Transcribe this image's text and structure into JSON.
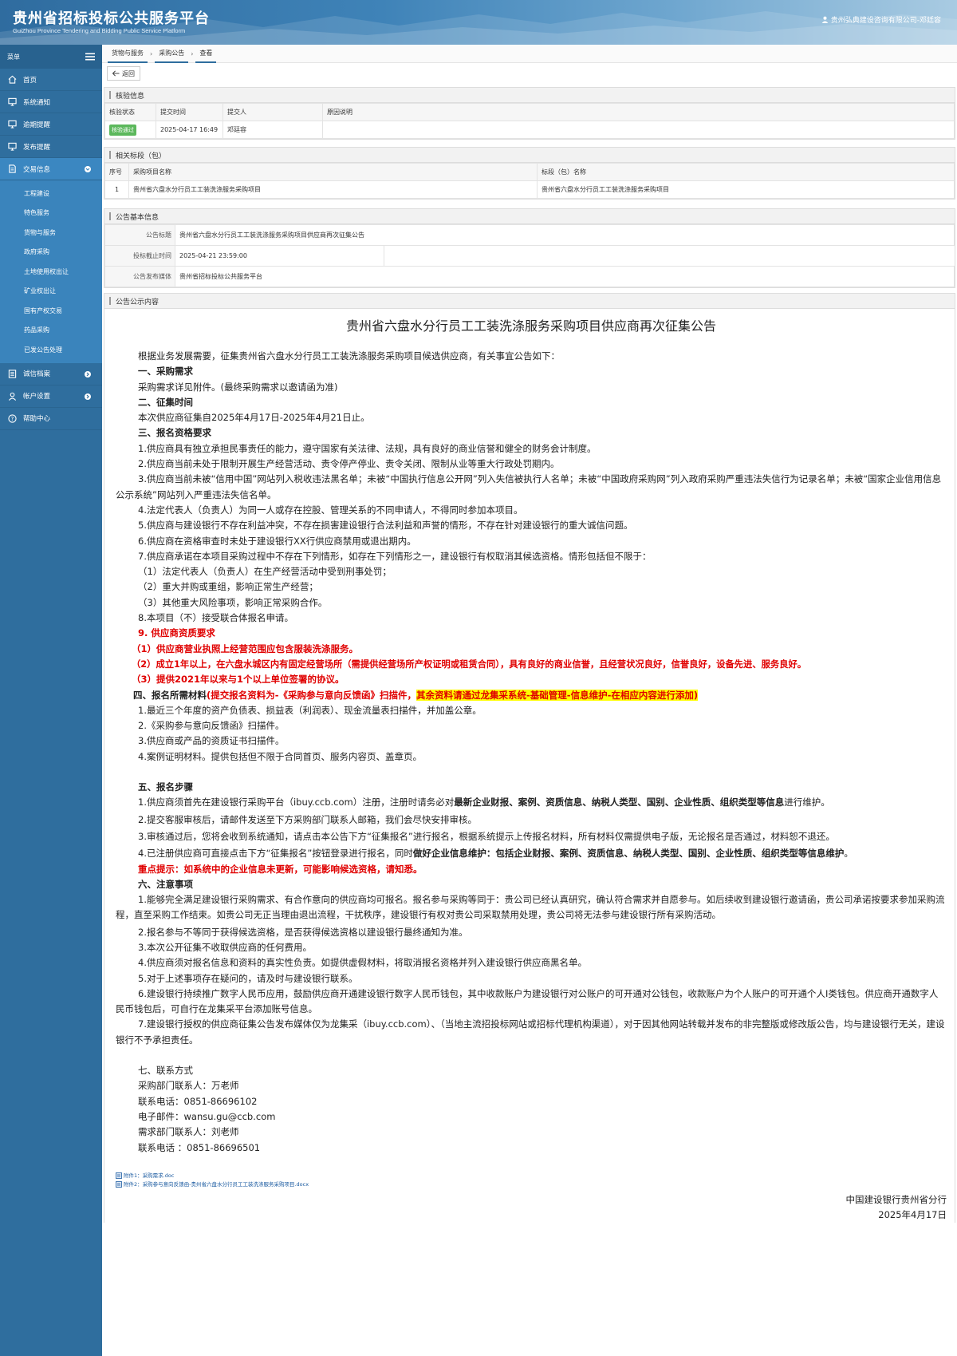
{
  "header": {
    "title": "贵州省招标投标公共服务平台",
    "subtitle": "GuiZhou Province Tendering and Bidding Public Service Platform",
    "user": "贵州弘典建设咨询有限公司-邓廷容"
  },
  "sidebar": {
    "menu_label": "菜单",
    "items": [
      {
        "label": "首页",
        "icon": "home-icon"
      },
      {
        "label": "系统通知",
        "icon": "monitor-icon"
      },
      {
        "label": "逾期提醒",
        "icon": "monitor-icon"
      },
      {
        "label": "发布提醒",
        "icon": "monitor-icon"
      },
      {
        "label": "交易信息",
        "icon": "file-icon"
      },
      {
        "label": "诚信档案",
        "icon": "list-icon"
      },
      {
        "label": "帐户设置",
        "icon": "user-icon"
      },
      {
        "label": "帮助中心",
        "icon": "help-icon"
      }
    ],
    "subitems": [
      "工程建设",
      "特色服务",
      "货物与服务",
      "政府采购",
      "土地使用权出让",
      "矿业权出让",
      "国有产权交易",
      "药品采购",
      "已发公告处理"
    ]
  },
  "breadcrumb": [
    "货物与服务",
    "采购公告",
    "查看"
  ],
  "toolbar": {
    "back_label": "返回"
  },
  "audit": {
    "title": "核验信息",
    "headers": [
      "核验状态",
      "提交时间",
      "提交人",
      "原因说明"
    ],
    "status": "核验通过",
    "time": "2025-04-17 16:49",
    "person": "邓廷容",
    "reason": ""
  },
  "sections": {
    "title": "相关标段（包）",
    "headers": [
      "序号",
      "采购项目名称",
      "标段（包）名称"
    ],
    "rows": [
      {
        "no": "1",
        "project": "贵州省六盘水分行员工工装洗涤服务采购项目",
        "section": "贵州省六盘水分行员工工装洗涤服务采购项目"
      }
    ]
  },
  "basic": {
    "title": "公告基本信息",
    "title_label": "公告标题",
    "title_value": "贵州省六盘水分行员工工装洗涤服务采购项目供应商再次征集公告",
    "deadline_label": "投标截止时间",
    "deadline_value": "2025-04-21 23:59:00",
    "media_label": "公告发布媒体",
    "media_value": "贵州省招标投标公共服务平台"
  },
  "content": {
    "panel_title": "公告公示内容",
    "doc_title": "贵州省六盘水分行员工工装洗涤服务采购项目供应商再次征集公告",
    "intro": "根据业务发展需要，征集贵州省六盘水分行员工工装洗涤服务采购项目候选供应商，有关事宜公告如下：",
    "h1": "一、采购需求",
    "p1": "采购需求详见附件。(最终采购需求以邀请函为准)",
    "h2": "二、征集时间",
    "p2": "本次供应商征集自2025年4月17日-2025年4月21日止。",
    "h3": "三、报名资格要求",
    "q1": "1.供应商具有独立承担民事责任的能力，遵守国家有关法律、法规，具有良好的商业信誉和健全的财务会计制度。",
    "q2": "2.供应商当前未处于限制开展生产经营活动、责令停产停业、责令关闭、限制从业等重大行政处罚期内。",
    "q3": "3.供应商当前未被“信用中国”网站列入税收违法黑名单；未被“中国执行信息公开网”列入失信被执行人名单；未被“中国政府采购网”列入政府采购严重违法失信行为记录名单；未被“国家企业信用信息公示系统”网站列入严重违法失信名单。",
    "q4": "4.法定代表人（负责人）为同一人或存在控股、管理关系的不同申请人，不得同时参加本项目。",
    "q5": "5.供应商与建设银行不存在利益冲突，不存在损害建设银行合法利益和声誉的情形，不存在针对建设银行的重大诚信问题。",
    "q6": "6.供应商在资格审查时未处于建设银行XX行供应商禁用或退出期内。",
    "q7": "7.供应商承诺在本项目采购过程中不存在下列情形，如存在下列情形之一，建设银行有权取消其候选资格。情形包括但不限于：",
    "q7a": "（1）法定代表人（负责人）在生产经营活动中受到刑事处罚；",
    "q7b": "（2）重大并购或重组，影响正常生产经营；",
    "q7c": "（3）其他重大风险事项，影响正常采购合作。",
    "q8": "8.本项目（不）接受联合体报名申请。",
    "q9": "9. 供应商资质要求",
    "q9a": "（1）供应商营业执照上经营范围应包含服装洗涤服务。",
    "q9b": "（2）成立1年以上，在六盘水城区内有固定经营场所（需提供经营场所产权证明或租赁合同），具有良好的商业信誉，且经营状况良好，信誉良好，设备先进、服务良好。",
    "q9c": "（3）提供2021年以来与1个以上单位签署的协议。",
    "h4": "四、报名所需材料",
    "h4_red": "(提交报名资料为-《采购参与意向反馈函》扫描件，",
    "h4_hl": "其余资料请通过龙集采系统-基础管理-信息维护-在相应内容进行添加)",
    "m1": "1.最近三个年度的资产负债表、损益表（利润表）、现金流量表扫描件，并加盖公章。",
    "m2": "2.《采购参与意向反馈函》扫描件。",
    "m3": "3.供应商或产品的资质证书扫描件。",
    "m4": "4.案例证明材料。提供包括但不限于合同首页、服务内容页、盖章页。",
    "h5": "五、报名步骤",
    "s1a": "1.供应商须首先在建设银行采购平台（ibuy.ccb.com）注册，注册时请务必对",
    "s1b": "最新企业财报、案例、资质信息、纳税人类型、国别、企业性质、组织类型等信息",
    "s1c": "进行维护。",
    "s2": "2.提交客服审核后，请邮件发送至下方采购部门联系人邮箱，我们会尽快安排审核。",
    "s3": "3.审核通过后，您将会收到系统通知，请点击本公告下方“征集报名”进行报名，根据系统提示上传报名材料，所有材料仅需提供电子版，无论报名是否通过，材料恕不退还。",
    "s4a": "4.已注册供应商可直接点击下方“征集报名”按钮登录进行报名，同时",
    "s4b": "做好企业信息维护：包括企业财报、案例、资质信息、纳税人类型、国别、企业性质、组织类型等信息维护",
    "s4c": "。",
    "notice": "重点提示：如系统中的企业信息未更新，可能影响候选资格，请知悉。",
    "h6": "六、注意事项",
    "n1": "1.能够完全满足建设银行采购需求、有合作意向的供应商均可报名。报名参与采购等同于：贵公司已经认真研究，确认符合需求并自愿参与。如后续收到建设银行邀请函，贵公司承诺按要求参加采购流程，直至采购工作结束。如贵公司无正当理由退出流程，干扰秩序，建设银行有权对贵公司采取禁用处理，贵公司将无法参与建设银行所有采购活动。",
    "n2": "2.报名参与不等同于获得候选资格，是否获得候选资格以建设银行最终通知为准。",
    "n3": "3.本次公开征集不收取供应商的任何费用。",
    "n4": "4.供应商须对报名信息和资料的真实性负责。如提供虚假材料，将取消报名资格并列入建设银行供应商黑名单。",
    "n5": "5.对于上述事项存在疑问的，请及时与建设银行联系。",
    "n6": "6.建设银行持续推广数字人民币应用，鼓励供应商开通建设银行数字人民币钱包，其中收款账户为建设银行对公账户的可开通对公钱包，收款账户为个人账户的可开通个人I类钱包。供应商开通数字人民币钱包后，可自行在龙集采平台添加账号信息。",
    "n7": "7.建设银行授权的供应商征集公告发布媒体仅为龙集采（ibuy.ccb.com）、（当地主流招投标网站或招标代理机构渠道），对于因其他网站转载并发布的非完整版或修改版公告，均与建设银行无关，建设银行不予承担责任。",
    "h7": "七、联系方式",
    "c1": "采购部门联系人：万老师",
    "c2": "联系电话：0851-86696102",
    "c3": "电子邮件：wansu.gu@ccb.com",
    "c4": "需求部门联系人：刘老师",
    "c5": "联系电话 ：0851-86696501",
    "attach1": "附件1：采购需求.doc",
    "attach2": "附件2：采购参与意向反馈函-贵州省六盘水分行员工工装洗涤服务采购项目.docx",
    "sign1": "中国建设银行贵州省分行",
    "sign2": "2025年4月17日"
  }
}
